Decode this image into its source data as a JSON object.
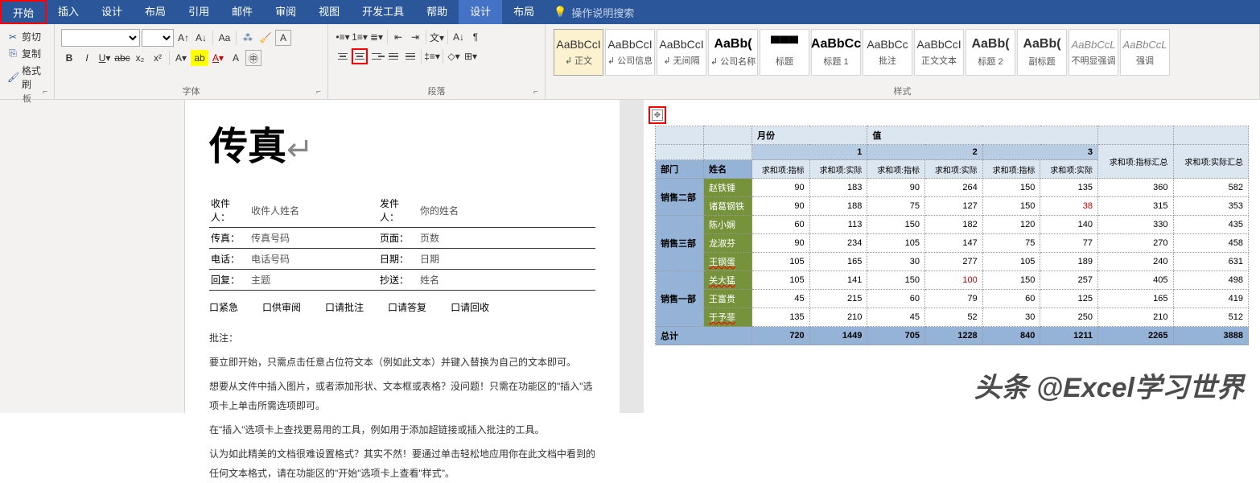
{
  "tabs": [
    "开始",
    "插入",
    "设计",
    "布局",
    "引用",
    "邮件",
    "审阅",
    "视图",
    "开发工具",
    "帮助",
    "设计",
    "布局"
  ],
  "search_placeholder": "操作说明搜索",
  "clipboard": {
    "cut": "剪切",
    "copy": "复制",
    "format_painter": "格式刷",
    "label": "板"
  },
  "groups": {
    "font": "字体",
    "paragraph": "段落",
    "styles": "样式"
  },
  "styles": [
    {
      "sample": "AaBbCcI",
      "name": "正文",
      "cls": ""
    },
    {
      "sample": "AaBbCcI",
      "name": "公司信息",
      "cls": ""
    },
    {
      "sample": "AaBbCcI",
      "name": "无间隔",
      "cls": ""
    },
    {
      "sample": "AaBb(",
      "name": "公司名称",
      "cls": "heading black"
    },
    {
      "sample": "▀▀▀",
      "name": "标题",
      "cls": "heading black"
    },
    {
      "sample": "AaBbCc",
      "name": "标题 1",
      "cls": "heading black"
    },
    {
      "sample": "AaBbCc",
      "name": "批注",
      "cls": ""
    },
    {
      "sample": "AaBbCcI",
      "name": "正文文本",
      "cls": ""
    },
    {
      "sample": "AaBb(",
      "name": "标题 2",
      "cls": "heading"
    },
    {
      "sample": "AaBb(",
      "name": "副标题",
      "cls": "heading"
    },
    {
      "sample": "AaBbCcL",
      "name": "不明显强调",
      "cls": "gray"
    },
    {
      "sample": "AaBbCcL",
      "name": "强调",
      "cls": "gray"
    }
  ],
  "fax": {
    "title": "传真",
    "rows": [
      [
        "收件人：",
        "收件人姓名",
        "发件人：",
        "你的姓名"
      ],
      [
        "传真：",
        "传真号码",
        "页面：",
        "页数"
      ],
      [
        "电话：",
        "电话号码",
        "日期：",
        "日期"
      ],
      [
        "回复：",
        "主题",
        "抄送：",
        "姓名"
      ]
    ],
    "checks": [
      "口紧急",
      "口供审阅",
      "口请批注",
      "口请答复",
      "口请回收"
    ],
    "note_label": "批注：",
    "paragraphs": [
      "要立即开始，只需点击任意占位符文本（例如此文本）并键入替换为自己的文本即可。",
      "想要从文件中插入图片，或者添加形状、文本框或表格？没问题！只需在功能区的\"插入\"选项卡上单击所需选项即可。",
      "在\"插入\"选项卡上查找更易用的工具，例如用于添加超链接或插入批注的工具。",
      "认为如此精美的文档很难设置格式？其实不然！要通过单击轻松地应用你在此文档中看到的任何文本格式，请在功能区的\"开始\"选项卡上查看\"样式\"。"
    ]
  },
  "chart_data": {
    "type": "table",
    "top_headers": {
      "month": "月份",
      "value": "值"
    },
    "month_nums": [
      "1",
      "2",
      "3"
    ],
    "sum_labels": {
      "target": "求和项:指标",
      "actual": "求和项:实际",
      "target_total": "求和项:指标汇总",
      "actual_total": "求和项:实际汇总"
    },
    "row_headers": {
      "dept": "部门",
      "name": "姓名"
    },
    "departments": [
      {
        "dept": "销售二部",
        "rows": [
          {
            "name": "赵铁锤",
            "v": [
              90,
              183,
              90,
              264,
              150,
              135,
              360,
              582
            ]
          },
          {
            "name": "诸葛钢铁",
            "v": [
              90,
              188,
              75,
              127,
              150,
              38,
              315,
              353
            ]
          }
        ]
      },
      {
        "dept": "销售三部",
        "rows": [
          {
            "name": "陈小娴",
            "v": [
              60,
              113,
              150,
              182,
              120,
              140,
              330,
              435
            ]
          },
          {
            "name": "龙淑芬",
            "v": [
              90,
              234,
              105,
              147,
              75,
              77,
              270,
              458
            ]
          },
          {
            "name": "王钢蛋",
            "v": [
              105,
              165,
              30,
              277,
              105,
              189,
              240,
              631
            ]
          }
        ]
      },
      {
        "dept": "销售一部",
        "rows": [
          {
            "name": "关大猛",
            "v": [
              105,
              141,
              150,
              100,
              150,
              257,
              405,
              498
            ]
          },
          {
            "name": "王富贵",
            "v": [
              45,
              215,
              60,
              79,
              60,
              125,
              165,
              419
            ]
          },
          {
            "name": "于予菲",
            "v": [
              135,
              210,
              45,
              52,
              30,
              250,
              210,
              512
            ]
          }
        ]
      }
    ],
    "total_label": "总计",
    "totals": [
      720,
      1449,
      705,
      1228,
      840,
      1211,
      2265,
      3888
    ],
    "red_cells": [
      "38",
      "100"
    ]
  },
  "watermark": "头条 @Excel学习世界"
}
